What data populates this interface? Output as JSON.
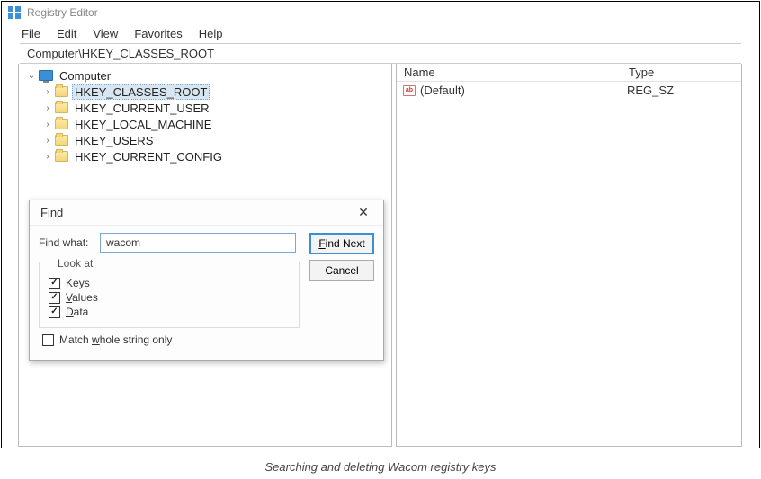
{
  "window": {
    "title": "Registry Editor"
  },
  "menubar": {
    "file": "File",
    "edit": "Edit",
    "view": "View",
    "favorites": "Favorites",
    "help": "Help"
  },
  "address": "Computer\\HKEY_CLASSES_ROOT",
  "tree": {
    "root": "Computer",
    "items": [
      "HKEY_CLASSES_ROOT",
      "HKEY_CURRENT_USER",
      "HKEY_LOCAL_MACHINE",
      "HKEY_USERS",
      "HKEY_CURRENT_CONFIG"
    ],
    "selected_index": 0
  },
  "list": {
    "columns": {
      "name": "Name",
      "type": "Type"
    },
    "rows": [
      {
        "name": "(Default)",
        "type": "REG_SZ"
      }
    ]
  },
  "dialog": {
    "title": "Find",
    "find_what_label": "Find what:",
    "find_what_value": "wacom",
    "find_next": "Find Next",
    "find_next_key": "F",
    "cancel": "Cancel",
    "look_at": "Look at",
    "keys": "Keys",
    "keys_key": "K",
    "values": "Values",
    "values_key": "V",
    "data": "Data",
    "data_key": "D",
    "match_whole": "Match whole string only",
    "match_whole_key": "w",
    "keys_checked": true,
    "values_checked": true,
    "data_checked": true,
    "match_checked": false
  },
  "caption": "Searching and deleting Wacom registry keys"
}
